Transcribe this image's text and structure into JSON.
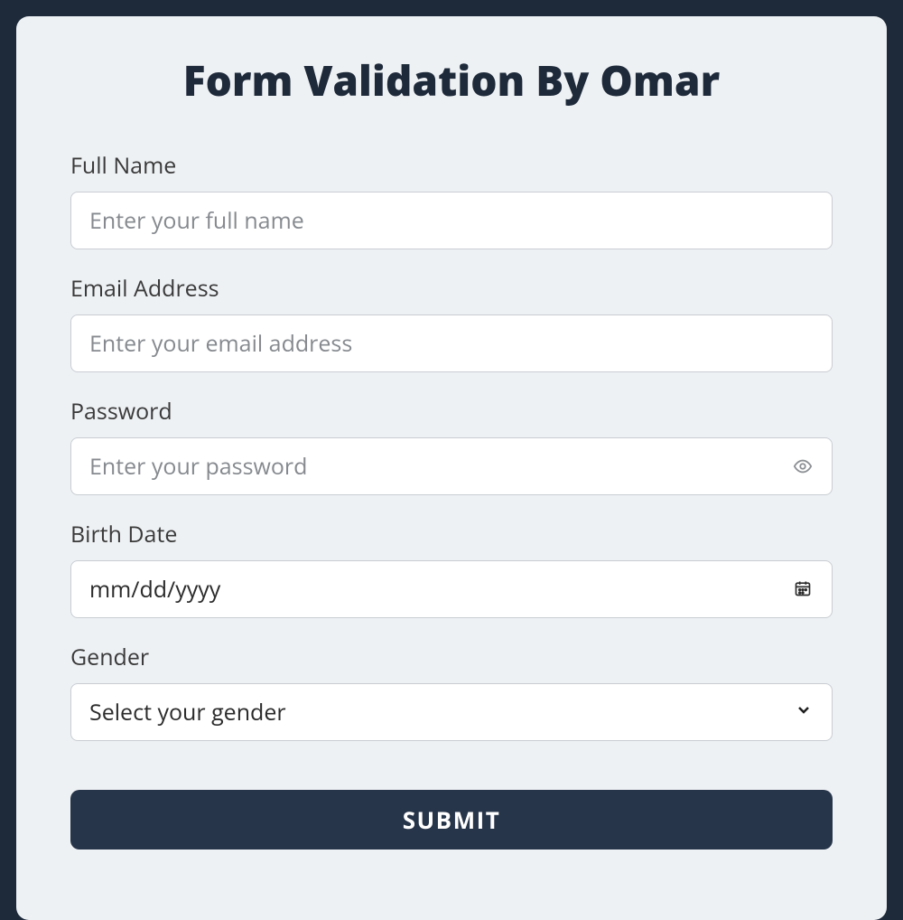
{
  "title": "Form Validation By Omar",
  "fields": {
    "fullname": {
      "label": "Full Name",
      "placeholder": "Enter your full name",
      "value": ""
    },
    "email": {
      "label": "Email Address",
      "placeholder": "Enter your email address",
      "value": ""
    },
    "password": {
      "label": "Password",
      "placeholder": "Enter your password",
      "value": ""
    },
    "birthdate": {
      "label": "Birth Date",
      "display": "mm/dd/yyyy"
    },
    "gender": {
      "label": "Gender",
      "selected": "Select your gender"
    }
  },
  "submit_label": "SUBMIT",
  "colors": {
    "page_bg": "#1e2a3a",
    "card_bg": "#eef1f4",
    "button_bg": "#27354a",
    "button_text": "#ffffff",
    "input_border": "#c9cdd2"
  }
}
